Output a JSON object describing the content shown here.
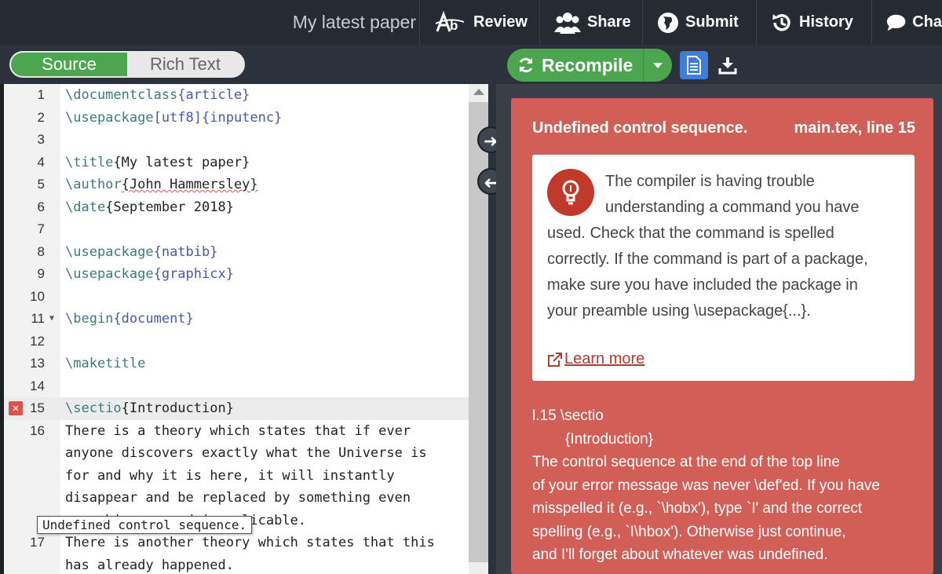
{
  "topbar": {
    "doc_title": "My latest paper",
    "nav": [
      {
        "label": "Review",
        "icon": "review-icon"
      },
      {
        "label": "Share",
        "icon": "share-icon"
      },
      {
        "label": "Submit",
        "icon": "globe-icon"
      },
      {
        "label": "History",
        "icon": "history-icon"
      },
      {
        "label": "Cha",
        "icon": "chat-icon"
      }
    ]
  },
  "editor": {
    "toggle_source": "Source",
    "toggle_rich": "Rich Text",
    "lines": [
      {
        "n": "1",
        "cmd": "\\documentclass",
        "arg": "{article}",
        "rest": ""
      },
      {
        "n": "2",
        "cmd": "\\usepackage",
        "arg": "[utf8]{inputenc}",
        "rest": ""
      },
      {
        "n": "3",
        "cmd": "",
        "arg": "",
        "rest": ""
      },
      {
        "n": "4",
        "cmd": "\\title",
        "arg": "",
        "rest": "{My latest paper}"
      },
      {
        "n": "5",
        "cmd": "\\author",
        "arg": "",
        "rest": "{John Hammersley}"
      },
      {
        "n": "6",
        "cmd": "\\date",
        "arg": "",
        "rest": "{September 2018}"
      },
      {
        "n": "7",
        "cmd": "",
        "arg": "",
        "rest": ""
      },
      {
        "n": "8",
        "cmd": "\\usepackage",
        "arg": "{natbib}",
        "rest": ""
      },
      {
        "n": "9",
        "cmd": "\\usepackage",
        "arg": "{graphicx}",
        "rest": ""
      },
      {
        "n": "10",
        "cmd": "",
        "arg": "",
        "rest": ""
      },
      {
        "n": "11",
        "cmd": "\\begin",
        "arg": "{document}",
        "rest": ""
      },
      {
        "n": "12",
        "cmd": "",
        "arg": "",
        "rest": ""
      },
      {
        "n": "13",
        "cmd": "\\maketitle",
        "arg": "",
        "rest": ""
      },
      {
        "n": "14",
        "cmd": "",
        "arg": "",
        "rest": ""
      },
      {
        "n": "15",
        "cmd": "\\sectio",
        "arg": "",
        "rest": "{Introduction}"
      }
    ],
    "line16": {
      "n": "16",
      "wrapped": [
        "There is a theory which states that if ever",
        "anyone discovers exactly what the Universe is",
        "for and why it is here, it will instantly",
        "disappear and be replaced by something even",
        "more bizarre and inexplicable."
      ]
    },
    "line17": {
      "n": "17",
      "wrapped": [
        "There is another theory which states that this",
        "has already happened."
      ]
    },
    "tooltip": "Undefined control sequence."
  },
  "pdf_toolbar": {
    "recompile": "Recompile"
  },
  "log": {
    "error_title": "Undefined control sequence.",
    "error_location": "main.tex, line 15",
    "hint": "The compiler is having trouble understanding a command you have used. Check that the command is spelled correctly. If the command is part of a package, make sure you have included the package in your preamble using \\usepackage{...}.",
    "learn_more": "Learn more",
    "raw_line1": "l.15 \\sectio",
    "raw_line2": "{Introduction}",
    "raw_message": "The control sequence at the end of the top line\nof your error message was never \\def'ed. If you have\nmisspelled it (e.g., `\\hobx'), type `I' and the correct\nspelling (e.g., `I\\hbox'). Otherwise just continue,\nand I'll forget about whatever was undefined."
  },
  "colors": {
    "accent_green": "#4ca650",
    "error_red": "#d15f58",
    "topbar": "#252a33"
  }
}
